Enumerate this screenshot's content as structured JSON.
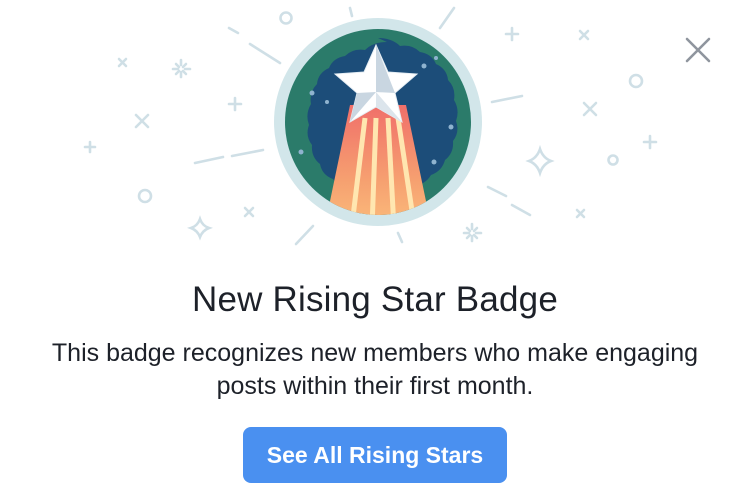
{
  "dialog": {
    "title": "New Rising Star Badge",
    "description": "This badge recognizes new members who make engaging posts within their first month.",
    "cta_label": "See All Rising Stars"
  },
  "icons": {
    "close": "close-icon",
    "badge": "rising-star-badge-icon"
  },
  "colors": {
    "button": "#4a90f0",
    "badge_ring": "#cde4e8",
    "badge_bg": "#1d4e78",
    "badge_wave": "#2e7a6a",
    "decor": "#cfdfe6"
  }
}
